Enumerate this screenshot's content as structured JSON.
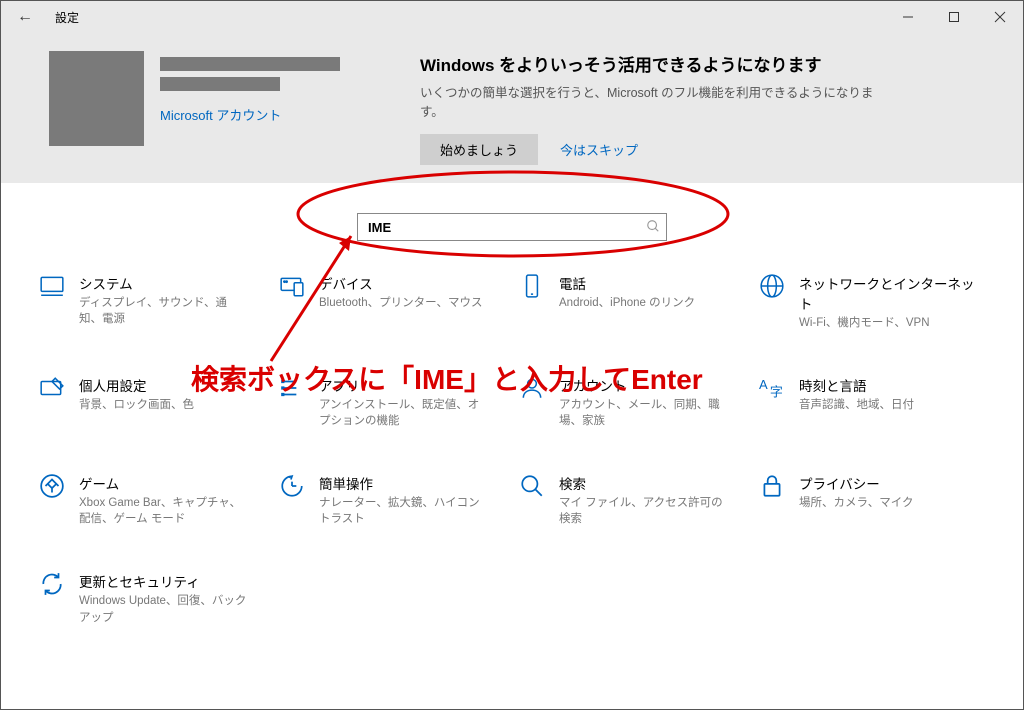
{
  "window": {
    "title": "設定"
  },
  "banner": {
    "ms_account_link": "Microsoft アカウント",
    "promo_title": "Windows をよりいっそう活用できるようになります",
    "promo_sub": "いくつかの簡単な選択を行うと、Microsoft のフル機能を利用できるようになります。",
    "start_button": "始めましょう",
    "skip_link": "今はスキップ"
  },
  "search": {
    "value": "IME"
  },
  "annotation": {
    "text": "検索ボックスに「IME」と入力してEnter"
  },
  "tiles": [
    {
      "title": "システム",
      "sub": "ディスプレイ、サウンド、通知、電源"
    },
    {
      "title": "デバイス",
      "sub": "Bluetooth、プリンター、マウス"
    },
    {
      "title": "電話",
      "sub": "Android、iPhone のリンク"
    },
    {
      "title": "ネットワークとインターネット",
      "sub": "Wi-Fi、機内モード、VPN"
    },
    {
      "title": "個人用設定",
      "sub": "背景、ロック画面、色"
    },
    {
      "title": "アプリ",
      "sub": "アンインストール、既定値、オプションの機能"
    },
    {
      "title": "アカウント",
      "sub": "アカウント、メール、同期、職場、家族"
    },
    {
      "title": "時刻と言語",
      "sub": "音声認識、地域、日付"
    },
    {
      "title": "ゲーム",
      "sub": "Xbox Game Bar、キャプチャ、配信、ゲーム モード"
    },
    {
      "title": "簡単操作",
      "sub": "ナレーター、拡大鏡、ハイコントラスト"
    },
    {
      "title": "検索",
      "sub": "マイ ファイル、アクセス許可の検索"
    },
    {
      "title": "プライバシー",
      "sub": "場所、カメラ、マイク"
    },
    {
      "title": "更新とセキュリティ",
      "sub": "Windows Update、回復、バックアップ"
    }
  ]
}
